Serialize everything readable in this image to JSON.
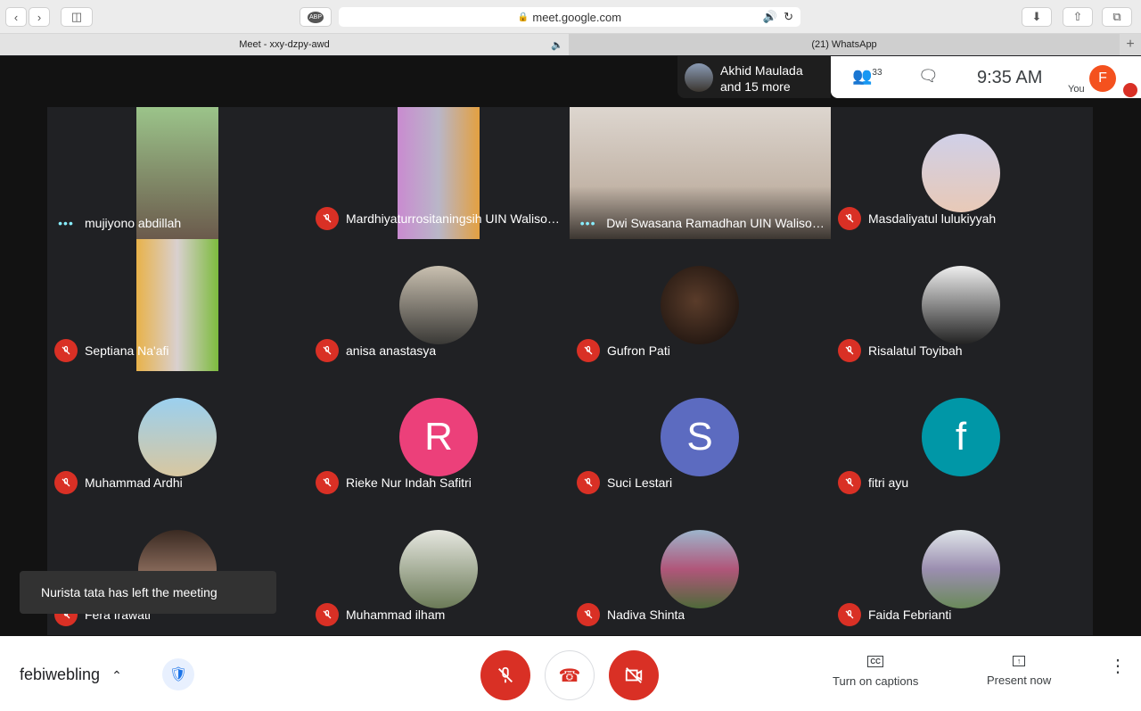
{
  "browser": {
    "url": "meet.google.com",
    "tabs": [
      {
        "label": "Meet - xxy-dzpy-awd"
      },
      {
        "label": "(21) WhatsApp"
      }
    ],
    "adblock": "ABP"
  },
  "header": {
    "presenter": "Akhid Maulada",
    "presenter_more": "and 15 more",
    "participants_count": "33",
    "time": "9:35 AM",
    "self_label": "You",
    "self_initial": "F"
  },
  "participants": [
    {
      "name": "mujiyono abdillah",
      "status": "speaking",
      "type": "video"
    },
    {
      "name": "Mardhiyaturrositaningsih UIN Walisongo",
      "status": "muted",
      "type": "video"
    },
    {
      "name": "Dwi Swasana Ramadhan UIN Walisongo",
      "status": "speaking",
      "type": "video"
    },
    {
      "name": "Masdaliyatul lulukiyyah",
      "status": "muted",
      "type": "photo"
    },
    {
      "name": "Septiana Na'afi",
      "status": "muted",
      "type": "video"
    },
    {
      "name": "anisa anastasya",
      "status": "muted",
      "type": "photo"
    },
    {
      "name": "Gufron Pati",
      "status": "muted",
      "type": "photo"
    },
    {
      "name": "Risalatul Toyibah",
      "status": "muted",
      "type": "photo"
    },
    {
      "name": "Muhammad Ardhi",
      "status": "muted",
      "type": "photo"
    },
    {
      "name": "Rieke Nur Indah Safitri",
      "status": "muted",
      "type": "initial",
      "initial": "R",
      "color": "#ec407a"
    },
    {
      "name": "Suci Lestari",
      "status": "muted",
      "type": "initial",
      "initial": "S",
      "color": "#5c6bc0"
    },
    {
      "name": "fitri ayu",
      "status": "muted",
      "type": "initial",
      "initial": "f",
      "color": "#0097a7"
    },
    {
      "name": "Fera Irawati",
      "status": "muted",
      "type": "photo"
    },
    {
      "name": "Muhammad ilham",
      "status": "muted",
      "type": "photo"
    },
    {
      "name": "Nadiva Shinta",
      "status": "muted",
      "type": "photo"
    },
    {
      "name": "Faida Febrianti",
      "status": "muted",
      "type": "photo"
    }
  ],
  "toast": "Nurista tata has left the meeting",
  "footer": {
    "meeting_name": "febiwebling",
    "captions_label": "Turn on captions",
    "present_label": "Present now"
  },
  "colors": {
    "danger": "#d93025",
    "self_avatar": "#f4511e"
  }
}
